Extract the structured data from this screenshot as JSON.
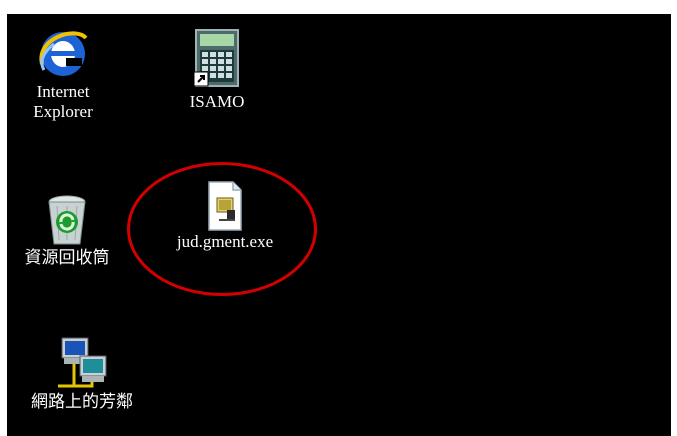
{
  "desktop": {
    "icons": [
      {
        "id": "ie",
        "label_line1": "Internet",
        "label_line2": "Explorer",
        "icon": "internet-explorer-icon"
      },
      {
        "id": "isamo",
        "label": "ISAMO",
        "icon": "calculator-shortcut-icon"
      },
      {
        "id": "recycle",
        "label": "資源回收筒",
        "icon": "recycle-bin-icon"
      },
      {
        "id": "jud",
        "label": "jud.gment.exe",
        "icon": "exe-file-icon"
      },
      {
        "id": "network",
        "label": "網路上的芳鄰",
        "icon": "network-neighborhood-icon"
      }
    ],
    "highlight_color": "#d40000"
  }
}
